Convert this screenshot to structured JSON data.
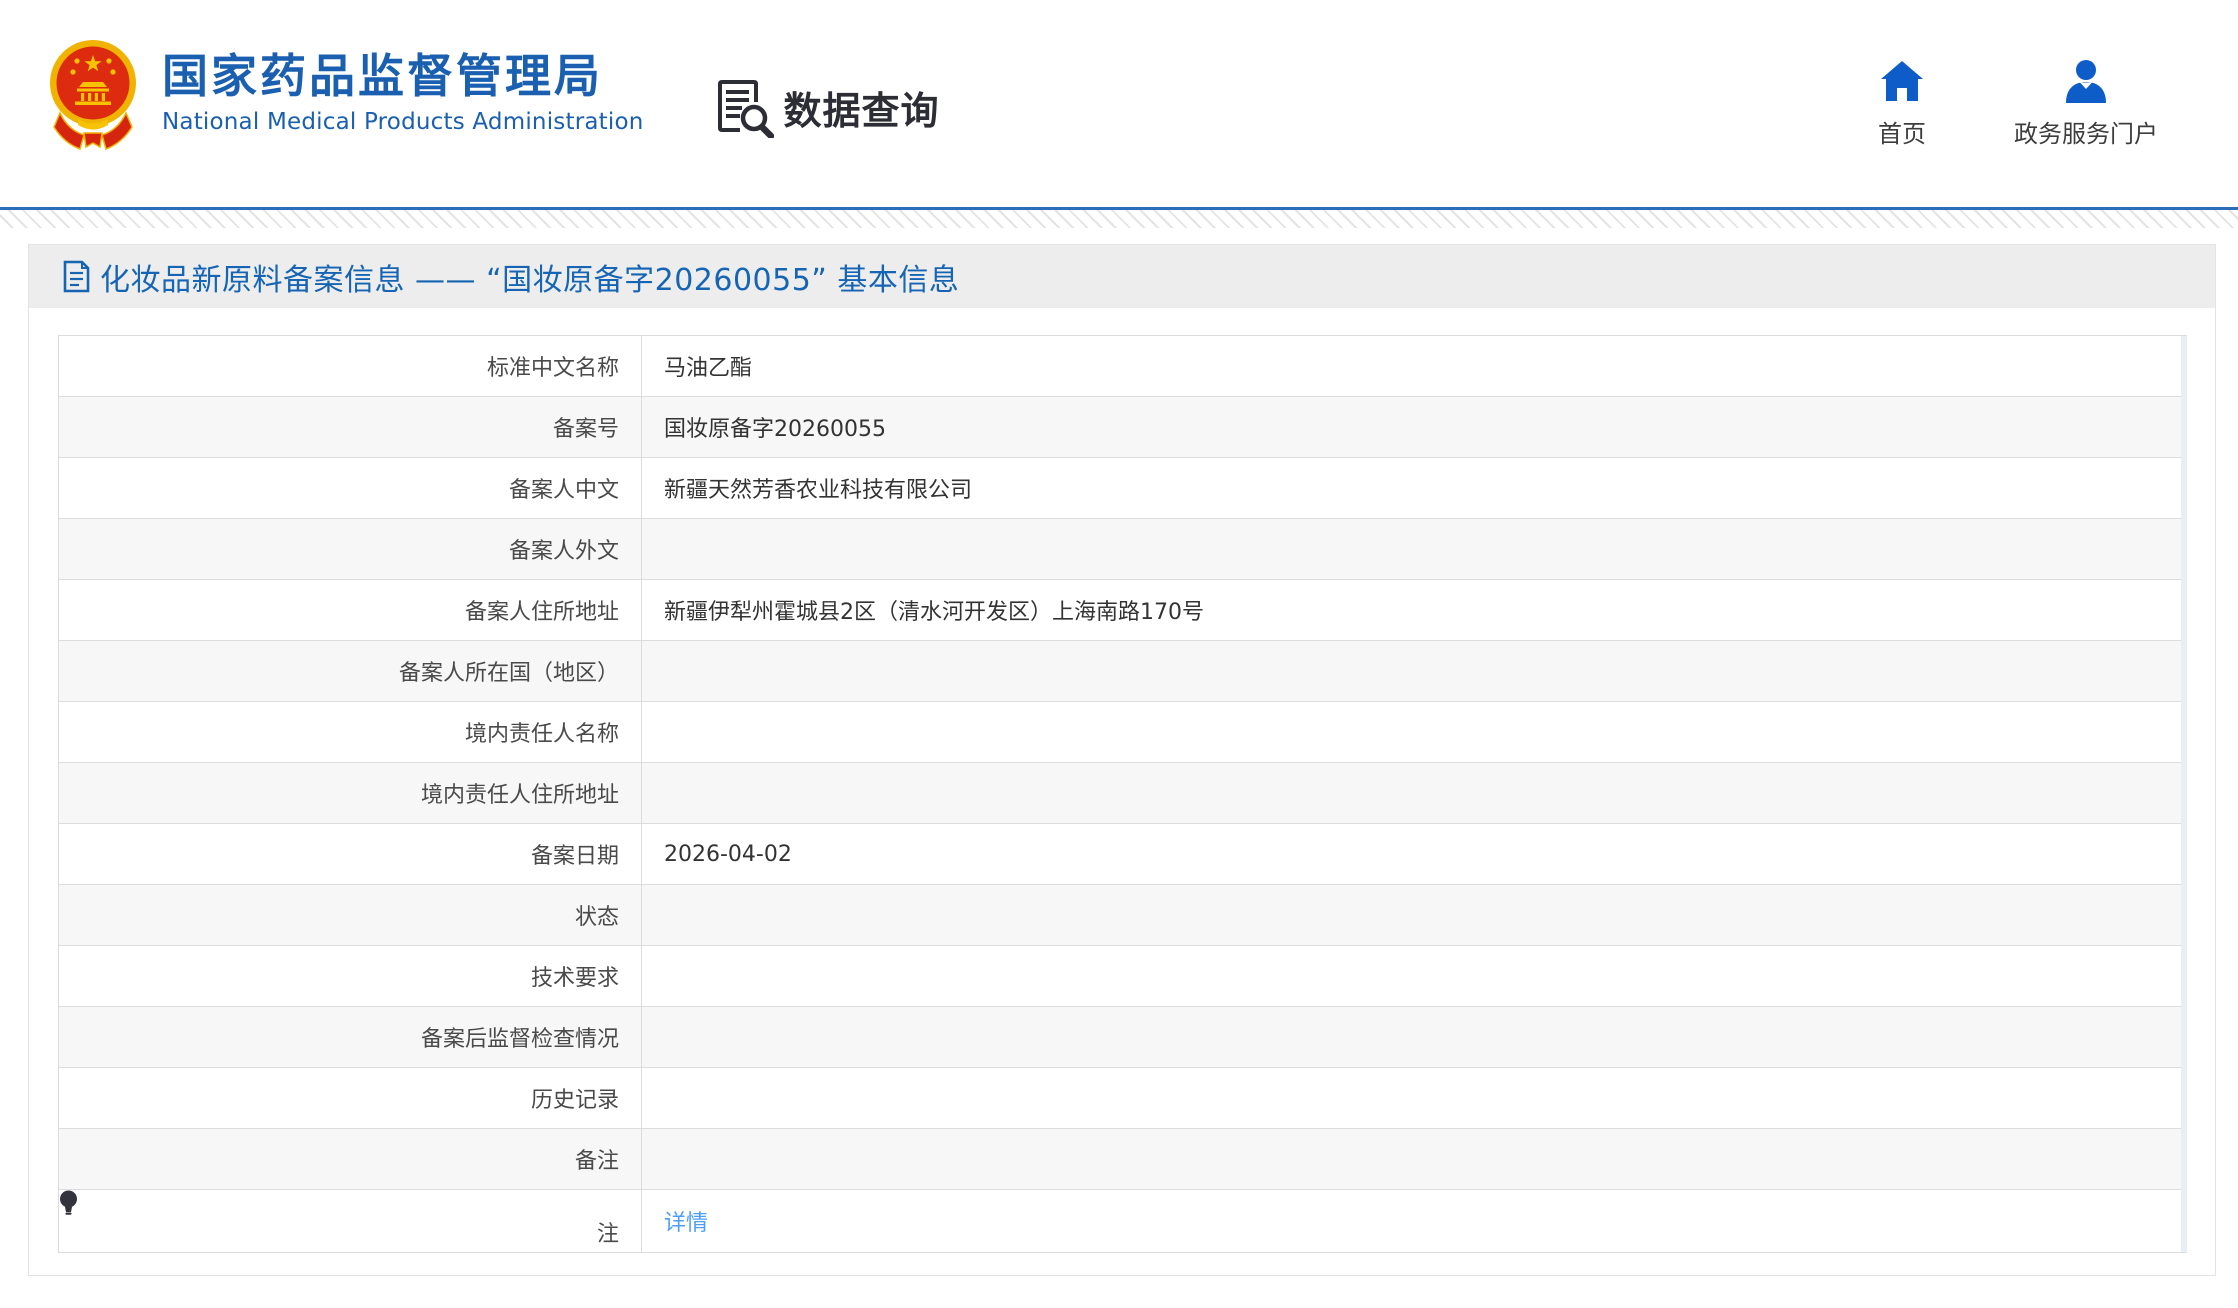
{
  "header": {
    "logo": {
      "emblem_icon": "china-national-emblem",
      "org_name_cn": "国家药品监督管理局",
      "org_name_en": "National Medical Products Administration"
    },
    "query": {
      "icon": "doc-search-icon",
      "label": "数据查询"
    },
    "nav": {
      "home": {
        "icon": "home-icon",
        "label": "首页"
      },
      "portal": {
        "icon": "user-icon",
        "label": "政务服务门户"
      }
    }
  },
  "page": {
    "title_icon": "document-icon",
    "title": "化妆品新原料备案信息 —— “国妆原备字20260055” 基本信息"
  },
  "table": {
    "rows": [
      {
        "label": "标准中文名称",
        "value": "马油乙酯"
      },
      {
        "label": "备案号",
        "value": "国妆原备字20260055"
      },
      {
        "label": "备案人中文",
        "value": "新疆天然芳香农业科技有限公司"
      },
      {
        "label": "备案人外文",
        "value": ""
      },
      {
        "label": "备案人住所地址",
        "value": "新疆伊犁州霍城县2区（清水河开发区）上海南路170号"
      },
      {
        "label": "备案人所在国（地区）",
        "value": ""
      },
      {
        "label": "境内责任人名称",
        "value": ""
      },
      {
        "label": "境内责任人住所地址",
        "value": ""
      },
      {
        "label": "备案日期",
        "value": "2026-04-02"
      },
      {
        "label": "状态",
        "value": ""
      },
      {
        "label": "技术要求",
        "value": ""
      },
      {
        "label": "备案后监督检查情况",
        "value": ""
      },
      {
        "label": "历史记录",
        "value": ""
      },
      {
        "label": "备注",
        "value": ""
      },
      {
        "label": "注",
        "label_icon": "bulb-icon",
        "value": "详情",
        "value_is_link": true
      }
    ]
  },
  "colors": {
    "brand_blue": "#1a5fb0",
    "icon_blue": "#0d5cc7",
    "link_blue": "#4c9ff5",
    "divider_blue": "#2e6cb8",
    "titlebar_bg": "#ededed",
    "row_alt_bg": "#f7f7f7",
    "border": "#dcdcdc"
  }
}
